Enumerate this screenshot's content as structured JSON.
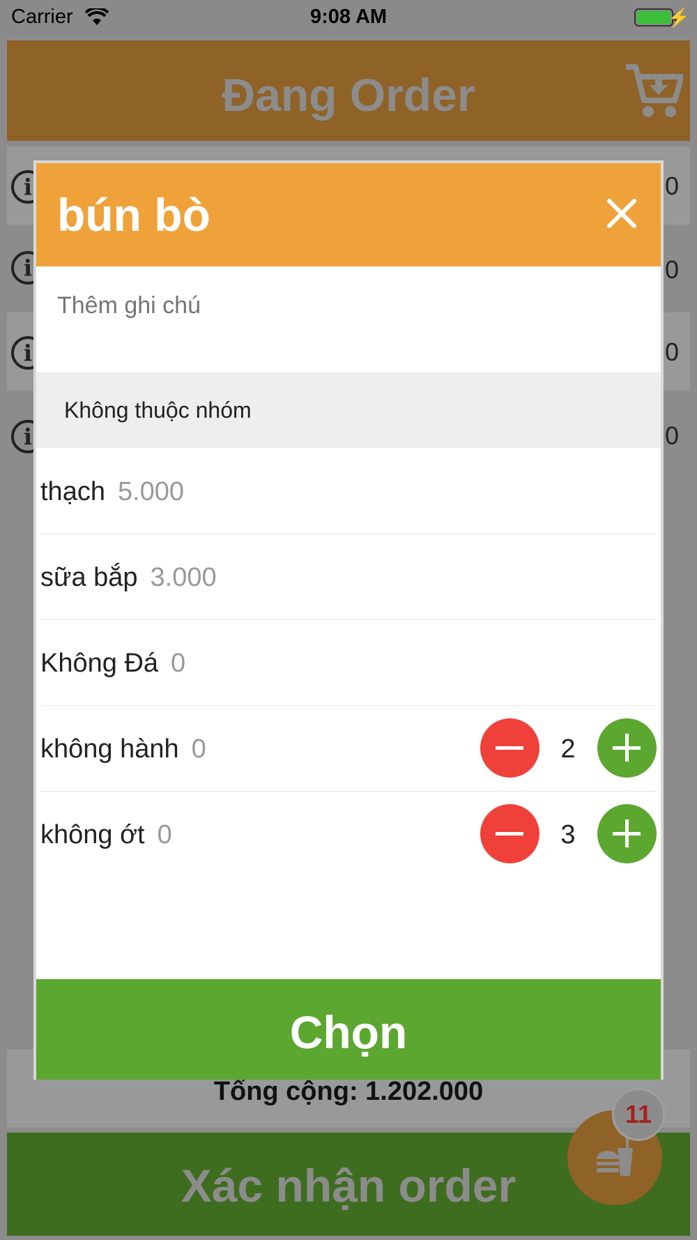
{
  "status_bar": {
    "carrier": "Carrier",
    "time": "9:08 AM"
  },
  "header": {
    "title": "Đang Order"
  },
  "background_rows": [
    {
      "price_suffix": "0"
    },
    {
      "price_suffix": "0"
    },
    {
      "price_suffix": "0"
    },
    {
      "price_suffix": "0"
    }
  ],
  "total": {
    "text": "Tổng cộng: 1.202.000"
  },
  "confirm": {
    "label": "Xác nhận order"
  },
  "fab": {
    "badge": "11"
  },
  "modal": {
    "title": "bún bò",
    "note_placeholder": "Thêm ghi chú",
    "group_label": "Không thuộc nhóm",
    "options": [
      {
        "name": "thạch",
        "price": "5.000"
      },
      {
        "name": "sữa bắp",
        "price": "3.000"
      },
      {
        "name": "Không Đá",
        "price": "0"
      },
      {
        "name": "không hành",
        "price": "0",
        "qty": "2"
      },
      {
        "name": "không ớt",
        "price": "0",
        "qty": "3"
      }
    ],
    "choose_label": "Chọn"
  },
  "colors": {
    "modal_header": "#f0a23a",
    "accent_green": "#5ca730",
    "minus_red": "#f0403a",
    "app_brown": "#8f6228"
  },
  "icons": [
    "wifi-icon",
    "battery-icon",
    "charging-bolt-icon",
    "cart-download-icon",
    "info-icon",
    "close-icon",
    "minus-icon",
    "plus-icon",
    "food-order-icon"
  ]
}
